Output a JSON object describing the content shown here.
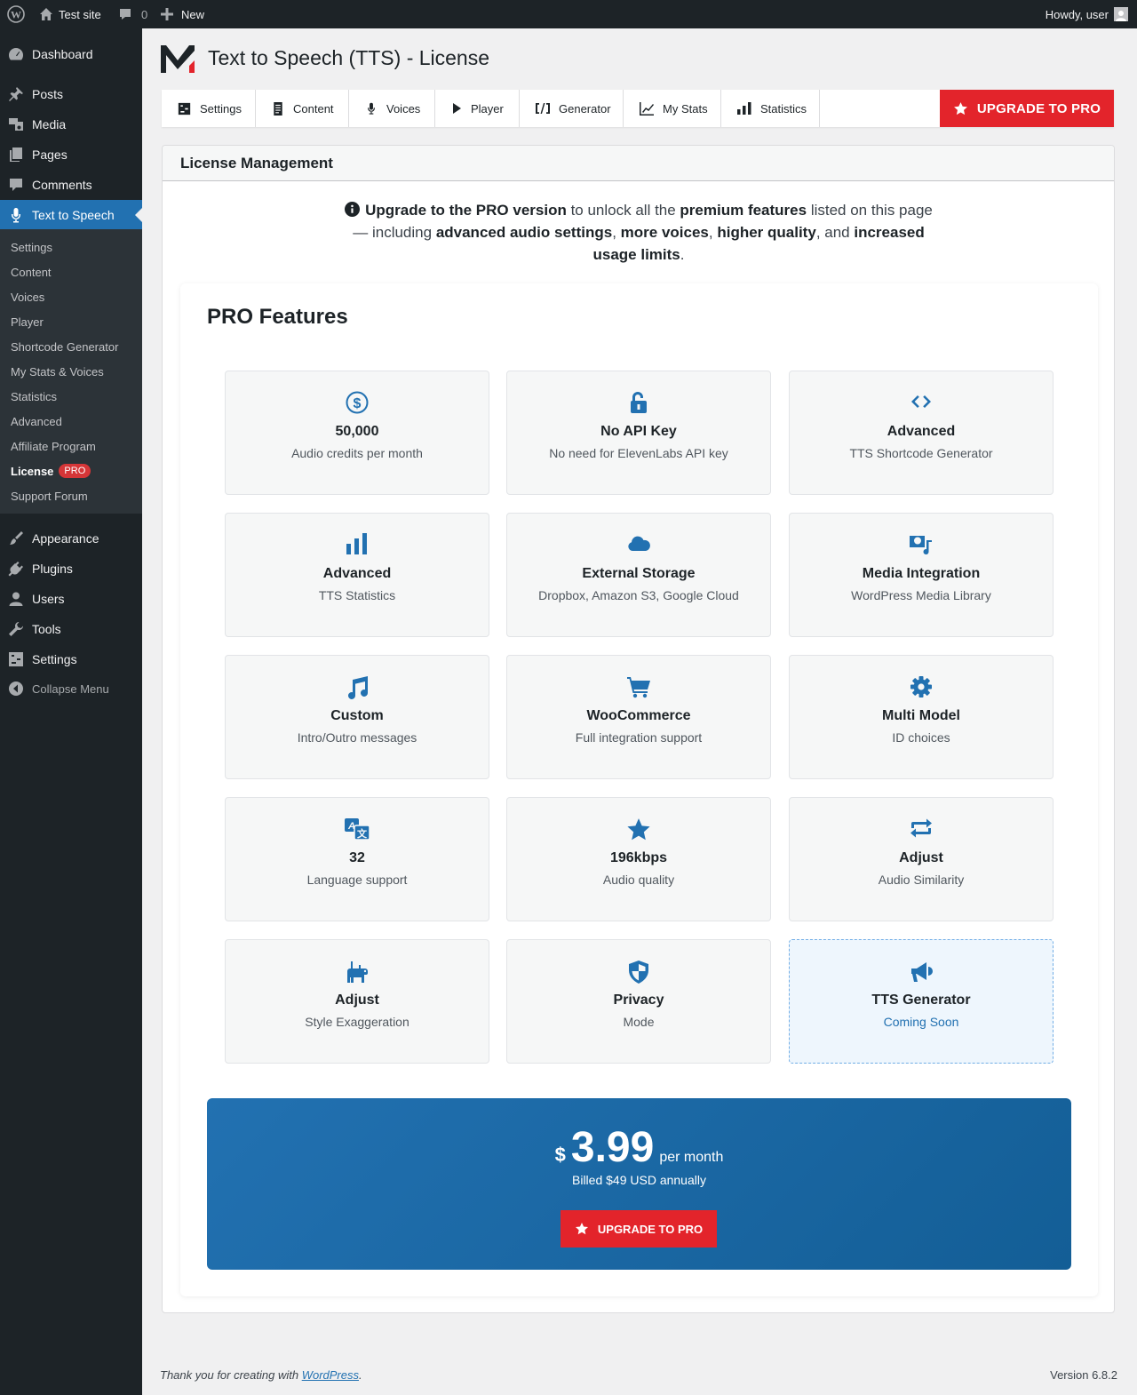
{
  "adminbar": {
    "site_name": "Test site",
    "comments_count": "0",
    "new_label": "New",
    "howdy": "Howdy, user"
  },
  "sidebar": {
    "items": [
      {
        "label": "Dashboard",
        "icon": "dashboard-icon"
      },
      {
        "label": "Posts",
        "icon": "pin-icon"
      },
      {
        "label": "Media",
        "icon": "media-icon"
      },
      {
        "label": "Pages",
        "icon": "pages-icon"
      },
      {
        "label": "Comments",
        "icon": "comment-icon"
      },
      {
        "label": "Text to Speech",
        "icon": "microphone-icon",
        "active": true
      },
      {
        "label": "Appearance",
        "icon": "brush-icon"
      },
      {
        "label": "Plugins",
        "icon": "plug-icon"
      },
      {
        "label": "Users",
        "icon": "user-icon"
      },
      {
        "label": "Tools",
        "icon": "wrench-icon"
      },
      {
        "label": "Settings",
        "icon": "settings-icon"
      }
    ],
    "submenu": [
      "Settings",
      "Content",
      "Voices",
      "Player",
      "Shortcode Generator",
      "My Stats & Voices",
      "Statistics",
      "Advanced",
      "Affiliate Program",
      "License",
      "Support Forum"
    ],
    "license_badge": "PRO",
    "collapse_label": "Collapse Menu"
  },
  "header": {
    "title": "Text to Speech (TTS) - License"
  },
  "tabs": [
    {
      "label": "Settings",
      "icon": "settings-icon"
    },
    {
      "label": "Content",
      "icon": "document-icon"
    },
    {
      "label": "Voices",
      "icon": "microphone-icon"
    },
    {
      "label": "Player",
      "icon": "play-icon"
    },
    {
      "label": "Generator",
      "icon": "shortcode-icon"
    },
    {
      "label": "My Stats",
      "icon": "line-chart-icon"
    },
    {
      "label": "Statistics",
      "icon": "bar-chart-icon"
    }
  ],
  "upgrade_label": "UPGRADE TO PRO",
  "panel": {
    "heading": "License Management",
    "notice": {
      "b1": "Upgrade to the PRO version",
      "t1": " to unlock all the ",
      "b2": "premium features",
      "t2": " listed on this page — including ",
      "b3": "advanced audio settings",
      "t3": ", ",
      "b4": "more voices",
      "t4": ", ",
      "b5": "higher quality",
      "t5": ", and ",
      "b6": "increased usage limits",
      "t6": "."
    },
    "pro_title": "PRO Features"
  },
  "features": [
    {
      "title": "50,000",
      "subtitle": "Audio credits per month",
      "icon": "dollar-icon"
    },
    {
      "title": "No API Key",
      "subtitle": "No need for ElevenLabs API key",
      "icon": "unlock-icon"
    },
    {
      "title": "Advanced",
      "subtitle": "TTS Shortcode Generator",
      "icon": "code-icon"
    },
    {
      "title": "Advanced",
      "subtitle": "TTS Statistics",
      "icon": "bar-chart-icon"
    },
    {
      "title": "External Storage",
      "subtitle": "Dropbox, Amazon S3, Google Cloud",
      "icon": "cloud-icon"
    },
    {
      "title": "Media Integration",
      "subtitle": "WordPress Media Library",
      "icon": "media-icon"
    },
    {
      "title": "Custom",
      "subtitle": "Intro/Outro messages",
      "icon": "music-icon"
    },
    {
      "title": "WooCommerce",
      "subtitle": "Full integration support",
      "icon": "cart-icon"
    },
    {
      "title": "Multi Model",
      "subtitle": "ID choices",
      "icon": "gear-icon"
    },
    {
      "title": "32",
      "subtitle": "Language support",
      "icon": "translate-icon"
    },
    {
      "title": "196kbps",
      "subtitle": "Audio quality",
      "icon": "star-icon"
    },
    {
      "title": "Adjust",
      "subtitle": "Audio Similarity",
      "icon": "repeat-icon"
    },
    {
      "title": "Adjust",
      "subtitle": "Style Exaggeration",
      "icon": "animal-icon"
    },
    {
      "title": "Privacy",
      "subtitle": "Mode",
      "icon": "shield-icon"
    },
    {
      "title": "TTS Generator",
      "subtitle": "Coming Soon",
      "icon": "megaphone-icon",
      "soon": true
    }
  ],
  "pricing": {
    "currency": "$",
    "amount": "3.99",
    "period": "per month",
    "billed": "Billed $49 USD annually"
  },
  "footer": {
    "thanks_prefix": "Thank you for creating with ",
    "link": "WordPress",
    "suffix": ".",
    "version": "Version 6.8.2"
  },
  "colors": {
    "accent": "#2271b1",
    "upgrade": "#e3242b",
    "sidebar": "#1d2327"
  }
}
